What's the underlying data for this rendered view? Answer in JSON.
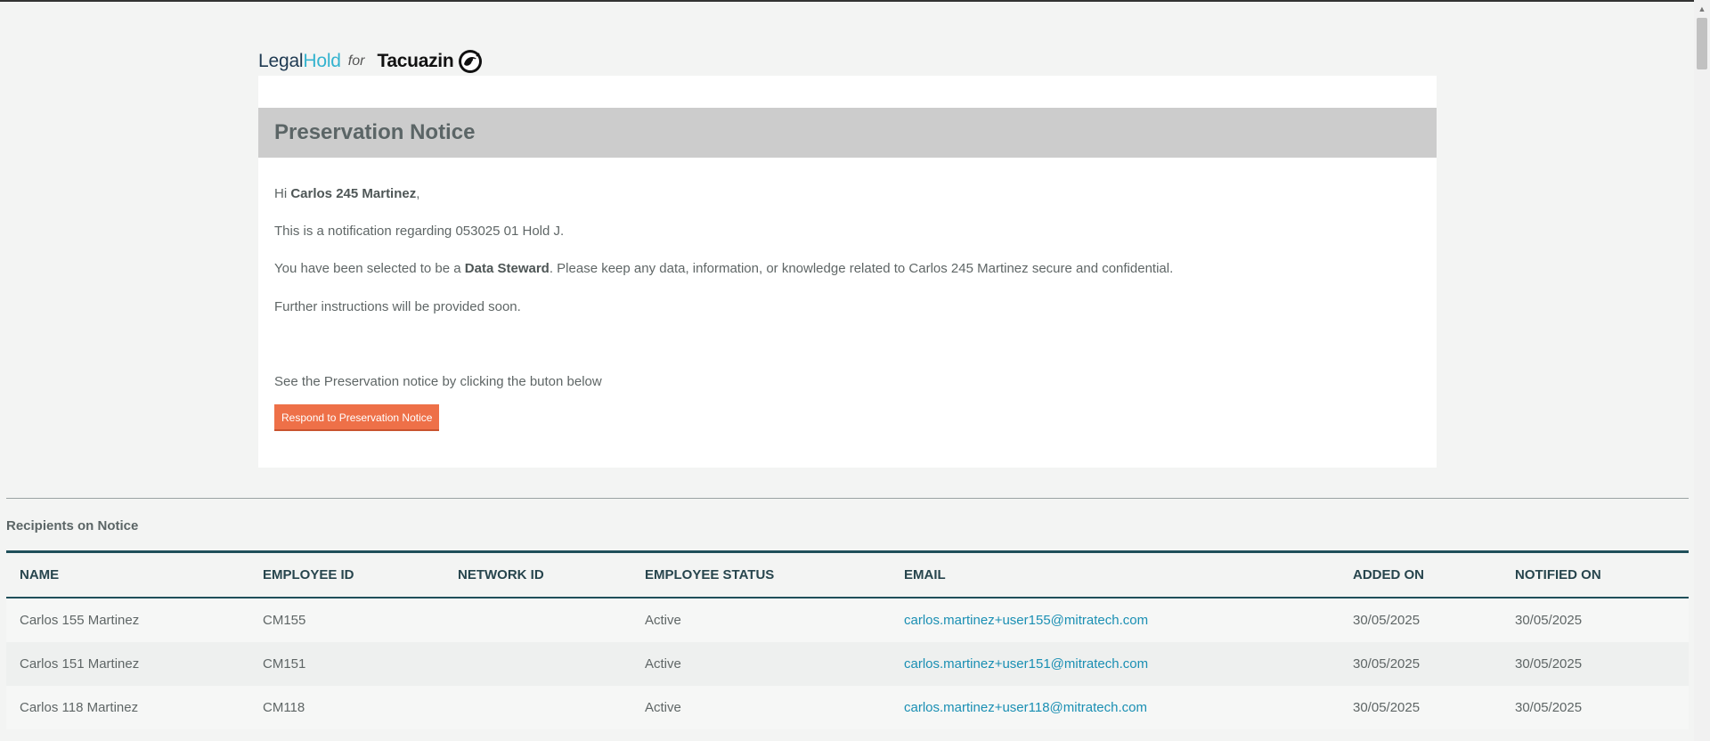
{
  "logo": {
    "legal": "Legal",
    "hold": "Hold",
    "for": "for",
    "company": "Tacuazin",
    "company_icon": "opossum-logo-icon"
  },
  "notice": {
    "title": "Preservation Notice",
    "greeting_prefix": "Hi ",
    "recipient_name": "Carlos 245 Martinez",
    "greeting_suffix": ",",
    "line1": "This is a notification regarding 053025 01 Hold J.",
    "line2_prefix": "You have been selected to be a ",
    "line2_role": "Data Steward",
    "line2_suffix": ". Please keep any data, information, or knowledge related to Carlos 245 Martinez secure and confidential.",
    "line3": "Further instructions will be provided soon.",
    "line4": "See the Preservation notice by clicking the buton below",
    "button_label": "Respond to Preservation Notice",
    "button_color": "#ee7048"
  },
  "recipients": {
    "section_title": "Recipients on Notice",
    "columns": [
      "NAME",
      "EMPLOYEE ID",
      "NETWORK ID",
      "EMPLOYEE STATUS",
      "EMAIL",
      "ADDED ON",
      "NOTIFIED ON"
    ],
    "rows": [
      {
        "name": "Carlos 155 Martinez",
        "employee_id": "CM155",
        "network_id": "",
        "status": "Active",
        "email": "carlos.martinez+user155@mitratech.com",
        "added_on": "30/05/2025",
        "notified_on": "30/05/2025"
      },
      {
        "name": "Carlos 151 Martinez",
        "employee_id": "CM151",
        "network_id": "",
        "status": "Active",
        "email": "carlos.martinez+user151@mitratech.com",
        "added_on": "30/05/2025",
        "notified_on": "30/05/2025"
      },
      {
        "name": "Carlos 118 Martinez",
        "employee_id": "CM118",
        "network_id": "",
        "status": "Active",
        "email": "carlos.martinez+user118@mitratech.com",
        "added_on": "30/05/2025",
        "notified_on": "30/05/2025"
      }
    ]
  },
  "colors": {
    "accent_link": "#1a8fb3",
    "header_band": "#cccccc",
    "table_rule": "#1f4f5a"
  }
}
